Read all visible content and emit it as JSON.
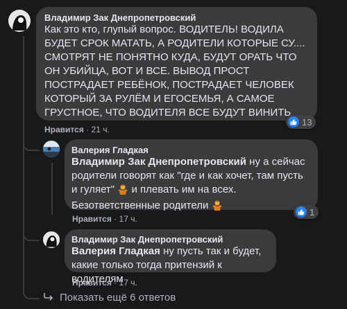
{
  "comments": [
    {
      "author": "Владимир Зак Днепропетровский",
      "text": "Как это кто, глупый вопрос. ВОДИТЕЛЬ! ВОДИЛА БУДЕТ СРОК МАТАТЬ, А РОДИТЕЛИ КОТОРЫЕ СУ.... СМОТРЯТ НЕ ПОНЯТНО КУДА, БУДУТ ОРАТЬ ЧТО ОН УБИЙЦА, ВОТ И ВСЕ. ВЫВОД ПРОСТ ПОСТРАДАЕТ РЕБЁНОК, ПОСТРАДАЕТ ЧЕЛОВЕК КОТОРЫЙ ЗА РУЛЁМ И ЕГОСЕМЬЯ, А САМОЕ ГРУСТНОЕ, ЧТО ВОДИТЕЛЯ ВСЕ БУДУТ ВИНИТЬ",
      "like_label": "Нравится",
      "separator": "·",
      "time": "21 ч.",
      "reaction_count": "13"
    },
    {
      "author": "Валерия Гладкая",
      "mention": "Владимир Зак Днепропетровский",
      "text_part1": " ну а сейчас родители говорят как \"где и как хочет, там пусть и гуляет\"",
      "text_part2": " и плевать им на всех. Безответственные родители",
      "like_label": "Нравится",
      "separator": "·",
      "time": "17 ч.",
      "reaction_count": "1"
    },
    {
      "author": "Владимир Зак Днепропетровский",
      "mention": "Валерия Гладкая",
      "text": " ну пусть так и будет, какие только тогда притензий к водителям",
      "like_label": "Нравится",
      "separator": "·",
      "time": "17 ч."
    }
  ],
  "show_more": "Показать ещё 6 ответов",
  "colors": {
    "background": "#18191a",
    "bubble": "#3a3b3c",
    "text": "#e4e6eb",
    "secondary": "#b0b3b8",
    "like_blue": "#1877f2"
  },
  "icons": {
    "reaction": "like-icon",
    "emoji": "person-shrugging-emoji",
    "reply_arrow": "reply-arrow-icon"
  }
}
